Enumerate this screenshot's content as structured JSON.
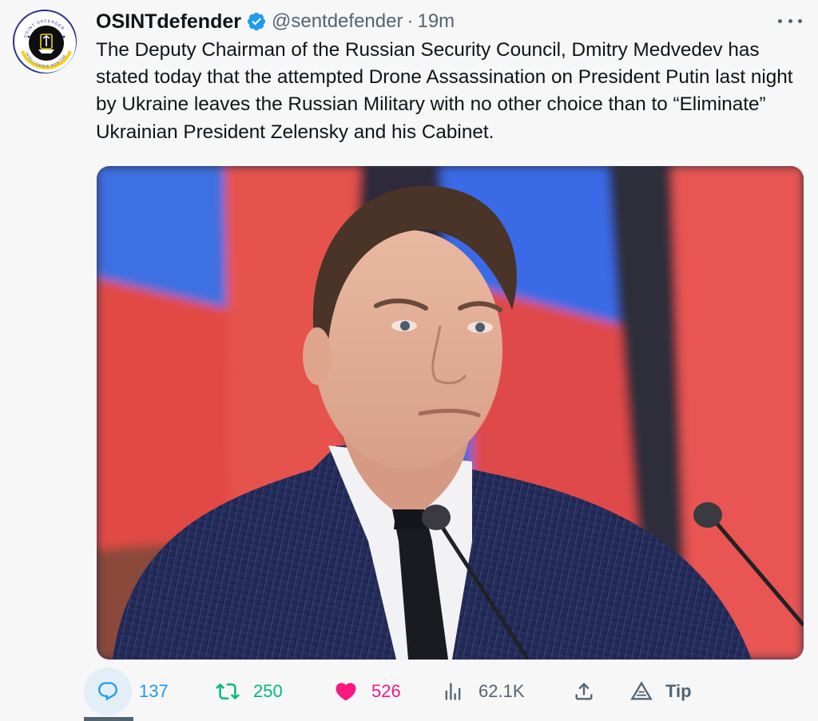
{
  "author": {
    "display_name": "OSINTdefender",
    "handle": "@sentdefender",
    "separator": "·",
    "time": "19m",
    "avatar_text_top": "OSINT DEFENDER",
    "avatar_text_bottom": "INTELLIGENCE MONITOR"
  },
  "tweet": {
    "text": "The Deputy Chairman of the Russian Security Council, Dmitry Medvedev has stated today that the attempted Drone Assassination on President Putin last night by Ukraine leaves the Russian Military with no other choice than to “Eliminate” Ukrainian President Zelensky and his Cabinet."
  },
  "actions": {
    "reply_count": "137",
    "retweet_count": "250",
    "like_count": "526",
    "views_count": "62.1K",
    "tip_label": "Tip"
  },
  "icons": {
    "reply": "reply-icon",
    "retweet": "retweet-icon",
    "like": "heart-icon",
    "views": "analytics-icon",
    "share": "share-icon",
    "tip": "tip-icon",
    "verified": "verified-badge-icon",
    "more": "more-icon"
  },
  "colors": {
    "accent": "#1d9bf0",
    "retweet": "#00ba7c",
    "like": "#f91880",
    "muted": "#536471",
    "text": "#0f1419"
  }
}
